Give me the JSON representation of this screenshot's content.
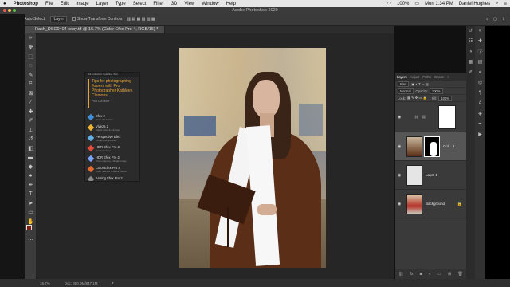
{
  "menubar": {
    "apple": "",
    "app": "Photoshop",
    "items": [
      "File",
      "Edit",
      "Image",
      "Layer",
      "Type",
      "Select",
      "Filter",
      "3D",
      "View",
      "Window",
      "Help"
    ],
    "battery": "100%",
    "clock": "Mon 1:34 PM",
    "user": "Daniel Hughes"
  },
  "window": {
    "title": "Adobe Photoshop 2020"
  },
  "options": {
    "auto_select": "Auto-Select:",
    "auto_select_value": "Layer",
    "show_transform": "Show Transform Controls"
  },
  "document": {
    "tab": "Rach_DSC0404 copy.tif @ 16.7% (Color Efex Pro 4, RGB/16) *"
  },
  "nik_panel": {
    "header": "Nik Collection Selective Tool",
    "promo": "Tips for photographing flowers with Pro Photographer Kathleen Clemons",
    "promo_more": "Find Out More",
    "filters": [
      {
        "name": "Efex 2",
        "sub": "Noise Reduction",
        "color": "#3f8fd8"
      },
      {
        "name": "Viveza 2",
        "sub": "Adjust color & contrast",
        "color": "#f0b232"
      },
      {
        "name": "Perspective Efex",
        "sub": "Correct perspective",
        "color": "#5fb0e6"
      },
      {
        "name": "HDR Efex Pro 2",
        "sub": "Tonal contrast",
        "color": "#e24a3b"
      },
      {
        "name": "HDR Efex Pro 2",
        "sub": "Tone mapping - Single image",
        "color": "#7aa4ff"
      },
      {
        "name": "Color Efex Pro 4",
        "sub": "Color filters & creative effects",
        "color": "#e56b2c"
      },
      {
        "name": "Analog Efex Pro 2",
        "sub": "",
        "color": "#8a8a8a"
      }
    ]
  },
  "layers_panel": {
    "tabs": [
      "Layers",
      "Adjust",
      "Paths",
      "Chann"
    ],
    "kind": "Kind",
    "blend_mode": "Normal",
    "opacity_label": "Opacity:",
    "opacity_value": "100%",
    "lock_label": "Lock:",
    "fill_label": "Fill:",
    "fill_value": "100%",
    "layers": [
      {
        "name": "",
        "thumb": "#ffffff"
      },
      {
        "name": "Col... 4",
        "thumb": "#7a4a2a"
      },
      {
        "name": "Layer 1",
        "thumb": "#e8e8e8"
      },
      {
        "name": "Background",
        "thumb": "#b84a3a"
      }
    ]
  },
  "status": {
    "zoom": "16.7%",
    "doc": "Doc: 350.0M/847.1M"
  }
}
